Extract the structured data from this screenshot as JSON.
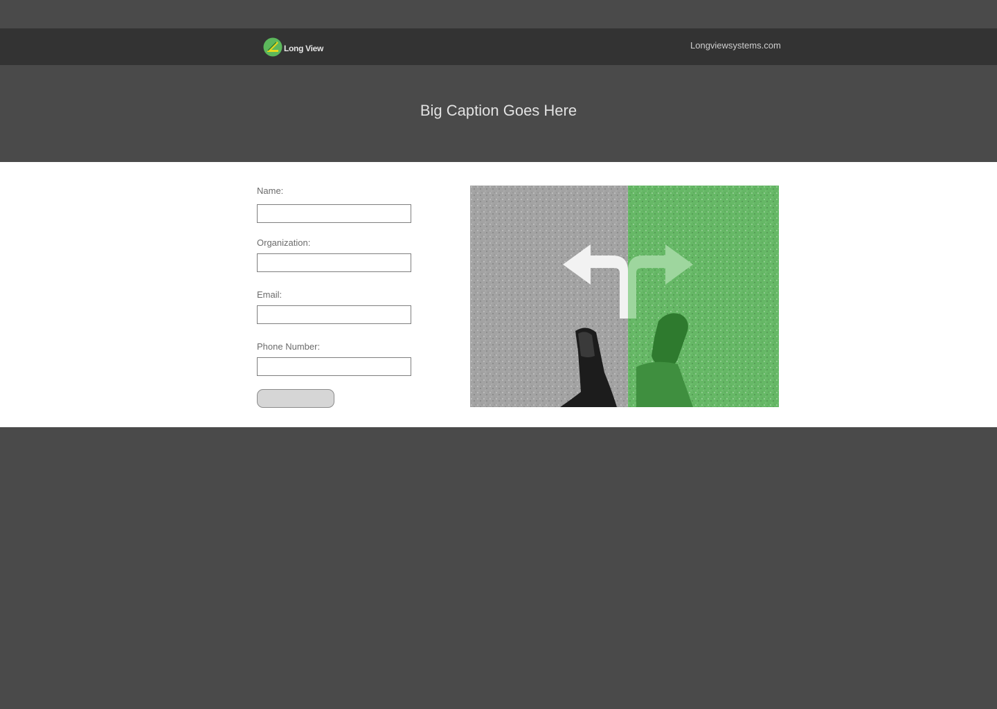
{
  "header": {
    "logo_text": "Long View",
    "site_link": "Longviewsystems.com"
  },
  "hero": {
    "caption": "Big Caption Goes Here"
  },
  "form": {
    "name_label": "Name:",
    "name_value": "",
    "organization_label": "Organization:",
    "organization_value": "",
    "email_label": "Email:",
    "email_value": "",
    "phone_label": "Phone Number:",
    "phone_value": "",
    "submit_label": ""
  },
  "image": {
    "subject": "feet-at-crossroads-arrows-image"
  },
  "colors": {
    "page_bg": "#4a4a4a",
    "header_bg": "#333333",
    "content_bg": "#ffffff",
    "accent_green": "#5cb85c",
    "logo_yellow": "#e5d81c"
  }
}
